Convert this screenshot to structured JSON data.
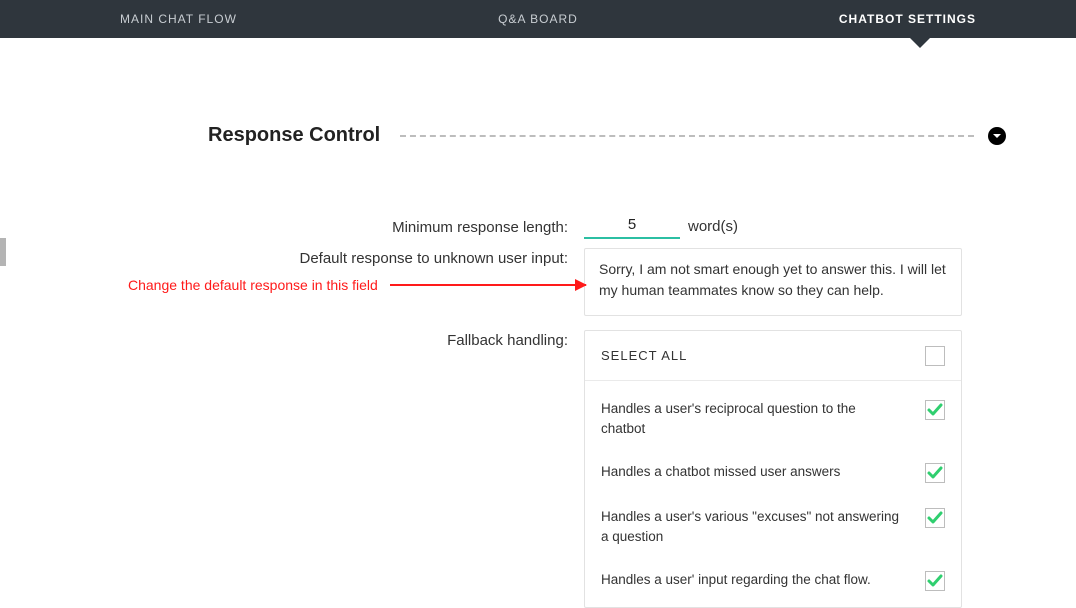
{
  "topbar": {
    "tabs": {
      "main": "MAIN CHAT FLOW",
      "qa": "Q&A BOARD",
      "settings": "CHATBOT SETTINGS"
    }
  },
  "section": {
    "title": "Response Control"
  },
  "form": {
    "min_length": {
      "label": "Minimum response length:",
      "value": "5",
      "unit": "word(s)"
    },
    "default_response": {
      "label": "Default response to unknown user input:",
      "value": "Sorry, I am not smart enough yet to answer this. I will let my human teammates know so they can help."
    },
    "fallback": {
      "label": "Fallback handling:",
      "select_all": "SELECT ALL",
      "select_all_checked": false,
      "items": [
        {
          "label": "Handles a user's reciprocal question to the chatbot",
          "checked": true
        },
        {
          "label": "Handles a chatbot missed user answers",
          "checked": true
        },
        {
          "label": "Handles a user's various \"excuses\" not answering a question",
          "checked": true
        },
        {
          "label": "Handles a user' input regarding the chat flow.",
          "checked": true
        }
      ]
    }
  },
  "annotation": {
    "text": "Change the default response in this field"
  }
}
